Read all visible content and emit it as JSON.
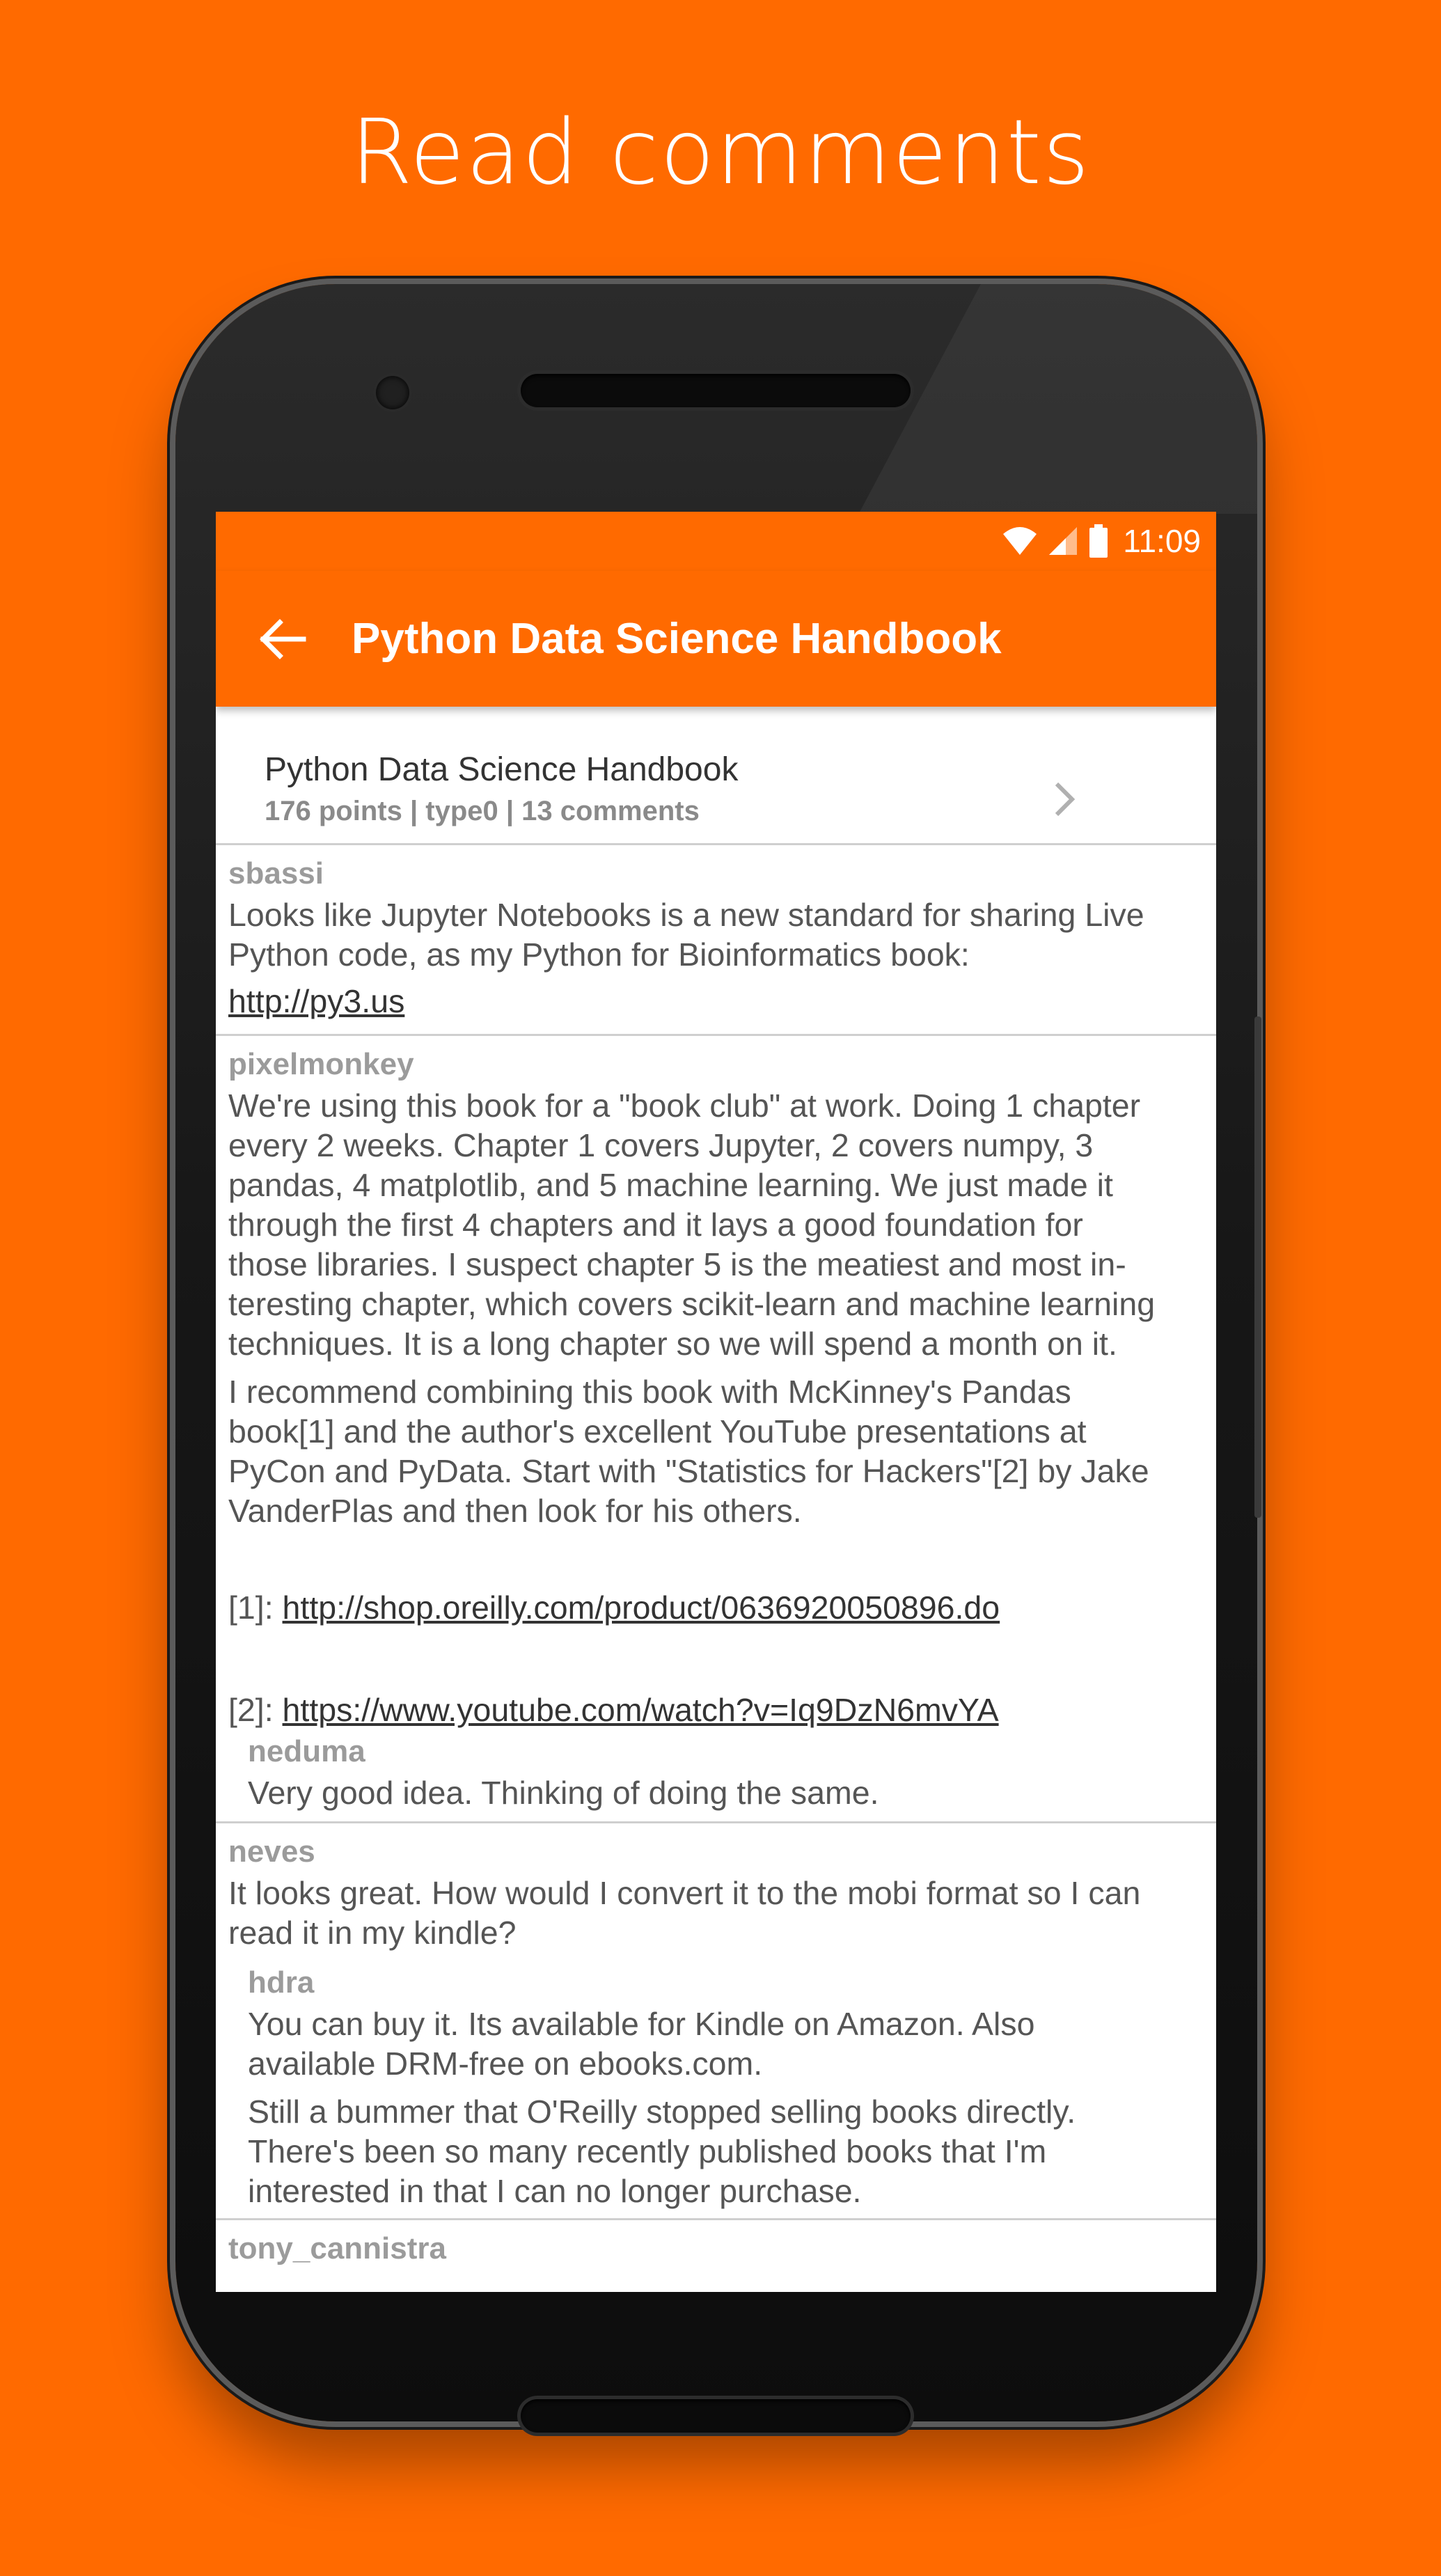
{
  "headline": "Read comments",
  "status_bar": {
    "time": "11:09",
    "icons": [
      "wifi-icon",
      "signal-icon",
      "battery-icon"
    ]
  },
  "app_bar": {
    "title": "Python Data Science Handbook",
    "back_icon": "arrow-left-icon"
  },
  "story": {
    "title": "Python Data Science Handbook",
    "meta": "176 points | type0 | 13 comments"
  },
  "comments": [
    {
      "author": "sbassi",
      "lines": [
        "Looks like Jupyter Notebooks is a new standard for sharing Live",
        "Python code, as my Python for Bioinformatics book:"
      ],
      "link": "http://py3.us"
    },
    {
      "author": "pixelmonkey",
      "p1": [
        "We're using this book for a \"book club\" at work. Doing 1 chapter",
        "every 2 weeks. Chapter 1 covers Jupyter, 2 covers numpy, 3",
        "pandas, 4 matplotlib, and 5 machine learning. We just made it",
        "through the first 4 chapters and it lays a good foundation for",
        "those libraries. I suspect chapter 5 is the meatiest and most in-",
        "teresting chapter, which covers scikit-learn and machine learning",
        "techniques. It is a long chapter so we will spend a month on it."
      ],
      "p2": [
        "I recommend combining this book with McKinney's Pandas",
        "book[1] and the author's excellent YouTube presentations at",
        "PyCon and PyData. Start with \"Statistics for Hackers\"[2] by Jake",
        "VanderPlas and then look for his others."
      ],
      "ref1_prefix": "[1]: ",
      "ref1_link": "http://shop.oreilly.com/product/0636920050896.do",
      "ref2_prefix": "[2]: ",
      "ref2_link": "https://www.youtube.com/watch?v=Iq9DzN6mvYA",
      "reply": {
        "author": "neduma",
        "text": "Very good idea. Thinking of doing the same."
      }
    },
    {
      "author": "neves",
      "lines": [
        "It looks great. How would I convert it to the mobi format so I can",
        "read it in my kindle?"
      ],
      "reply": {
        "author": "hdra",
        "p1": [
          "You can buy it. Its available for Kindle on Amazon. Also",
          "available DRM-free on ebooks.com."
        ],
        "p2": [
          "Still a bummer that O'Reilly stopped selling books directly.",
          "There's been so many recently published books that I'm",
          "interested in that I can no longer purchase."
        ]
      }
    },
    {
      "author": "tony_cannistra"
    }
  ]
}
